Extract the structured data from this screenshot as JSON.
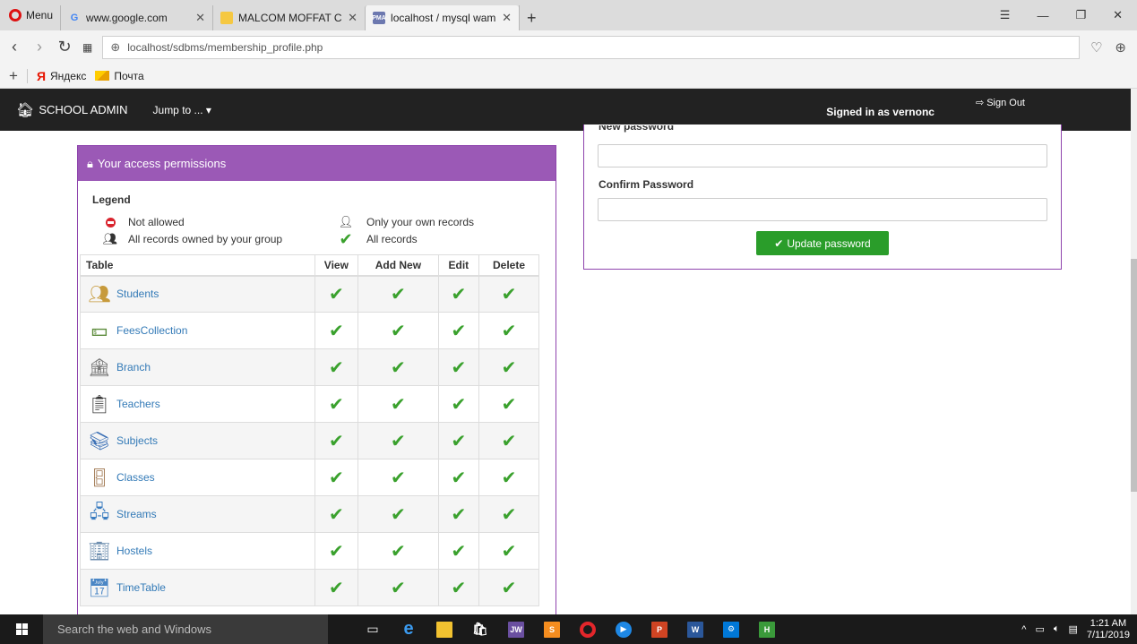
{
  "browser": {
    "menu_label": "Menu",
    "tabs": [
      {
        "title": "www.google.com",
        "icon": "google-icon"
      },
      {
        "title": "MALCOM MOFFAT COLLEG",
        "icon": "document-icon"
      },
      {
        "title": "localhost / mysql wampser",
        "icon": "phpmyadmin-icon"
      }
    ],
    "url": "localhost/sdbms/membership_profile.php",
    "bookmarks": [
      {
        "label": "Яндекс"
      },
      {
        "label": "Почта"
      }
    ]
  },
  "app": {
    "brand": "SCHOOL ADMIN",
    "jump_to": "Jump to ... ▾",
    "signed_in_prefix": "Signed in as",
    "username": "vernonc",
    "sign_out": "Sign Out"
  },
  "permissions": {
    "heading": "Your access permissions",
    "legend_title": "Legend",
    "legend": {
      "not_allowed": "Not allowed",
      "own_records": "Only your own records",
      "group_records": "All records owned by your group",
      "all_records": "All records"
    },
    "columns": [
      "Table",
      "View",
      "Add New",
      "Edit",
      "Delete"
    ],
    "rows": [
      {
        "name": "Students",
        "icon": "students-icon",
        "view": "all",
        "add": "all",
        "edit": "all",
        "delete": "all"
      },
      {
        "name": "FeesCollection",
        "icon": "money-icon",
        "view": "all",
        "add": "all",
        "edit": "all",
        "delete": "all"
      },
      {
        "name": "Branch",
        "icon": "bank-icon",
        "view": "all",
        "add": "all",
        "edit": "all",
        "delete": "all"
      },
      {
        "name": "Teachers",
        "icon": "chalkboard-icon",
        "view": "all",
        "add": "all",
        "edit": "all",
        "delete": "all"
      },
      {
        "name": "Subjects",
        "icon": "books-icon",
        "view": "all",
        "add": "all",
        "edit": "all",
        "delete": "all"
      },
      {
        "name": "Classes",
        "icon": "door-icon",
        "view": "all",
        "add": "all",
        "edit": "all",
        "delete": "all"
      },
      {
        "name": "Streams",
        "icon": "hierarchy-icon",
        "view": "all",
        "add": "all",
        "edit": "all",
        "delete": "all"
      },
      {
        "name": "Hostels",
        "icon": "building-icon",
        "view": "all",
        "add": "all",
        "edit": "all",
        "delete": "all"
      },
      {
        "name": "TimeTable",
        "icon": "calendar-icon",
        "view": "all",
        "add": "all",
        "edit": "all",
        "delete": "all"
      }
    ]
  },
  "password": {
    "new_label": "New password",
    "confirm_label": "Confirm Password",
    "new_value": "",
    "confirm_value": "",
    "button": "Update password"
  },
  "taskbar": {
    "search_placeholder": "Search the web and Windows",
    "time": "1:21 AM",
    "date": "7/11/2019",
    "app_labels": {
      "jw": "JW",
      "word": "W",
      "ppt": "P",
      "h": "H"
    }
  },
  "colors": {
    "navbar": "#222222",
    "panel_header": "#9b59b6",
    "panel_border": "#8e44ad",
    "check": "#3aa12d",
    "button": "#2a9d2a",
    "link": "#337ab7"
  }
}
